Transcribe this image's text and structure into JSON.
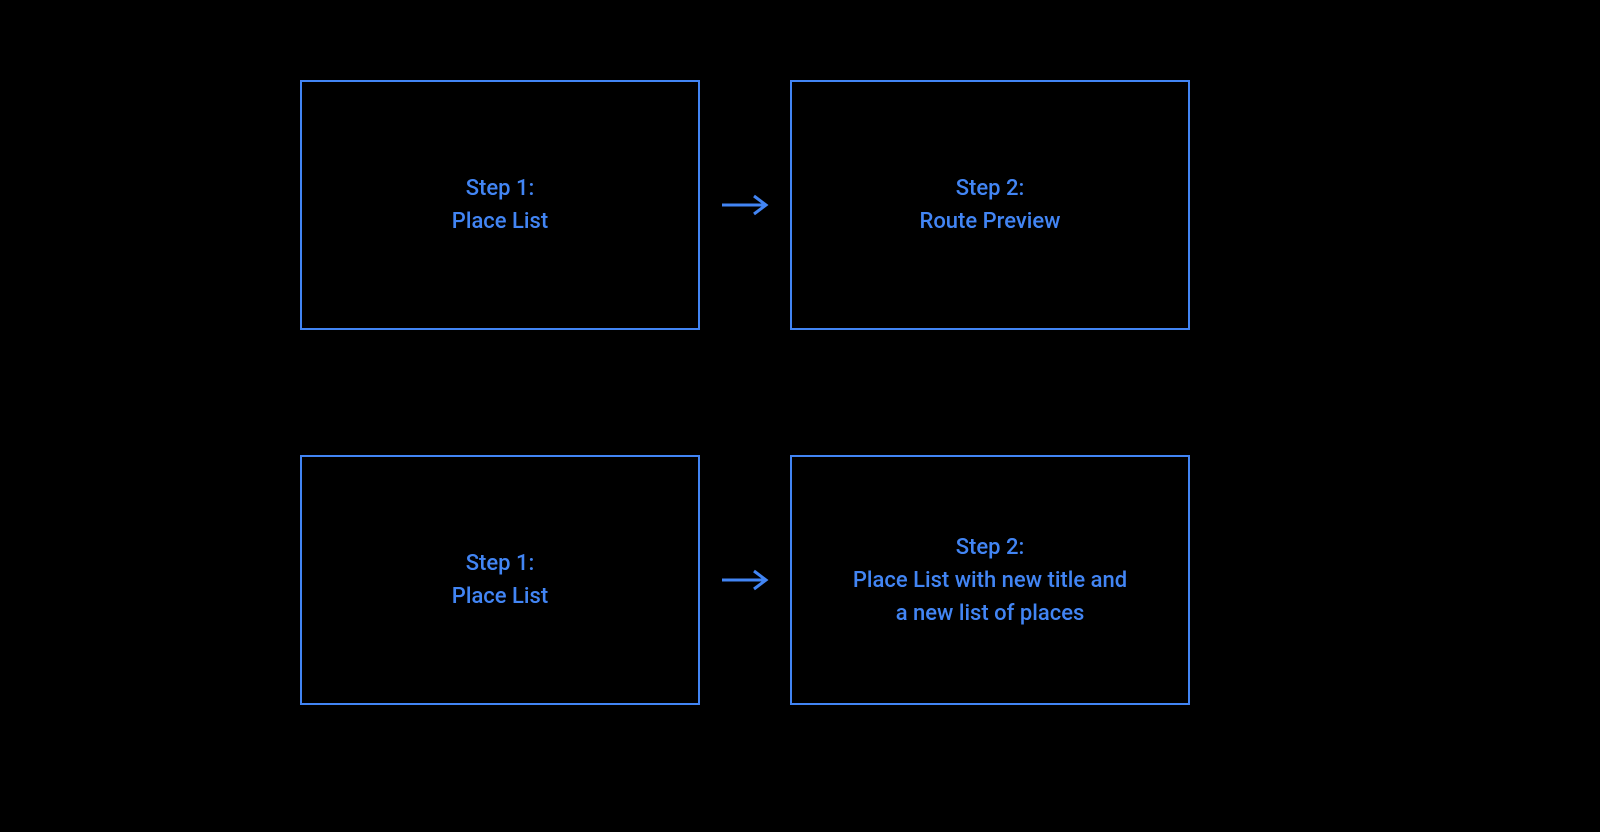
{
  "colors": {
    "accent": "#4285F4",
    "background": "#000000"
  },
  "flows": [
    {
      "step1": "Step 1:\nPlace List",
      "step2": "Step 2:\nRoute Preview"
    },
    {
      "step1": "Step 1:\nPlace List",
      "step2": "Step 2:\nPlace List with new title and\na new list of places"
    }
  ]
}
